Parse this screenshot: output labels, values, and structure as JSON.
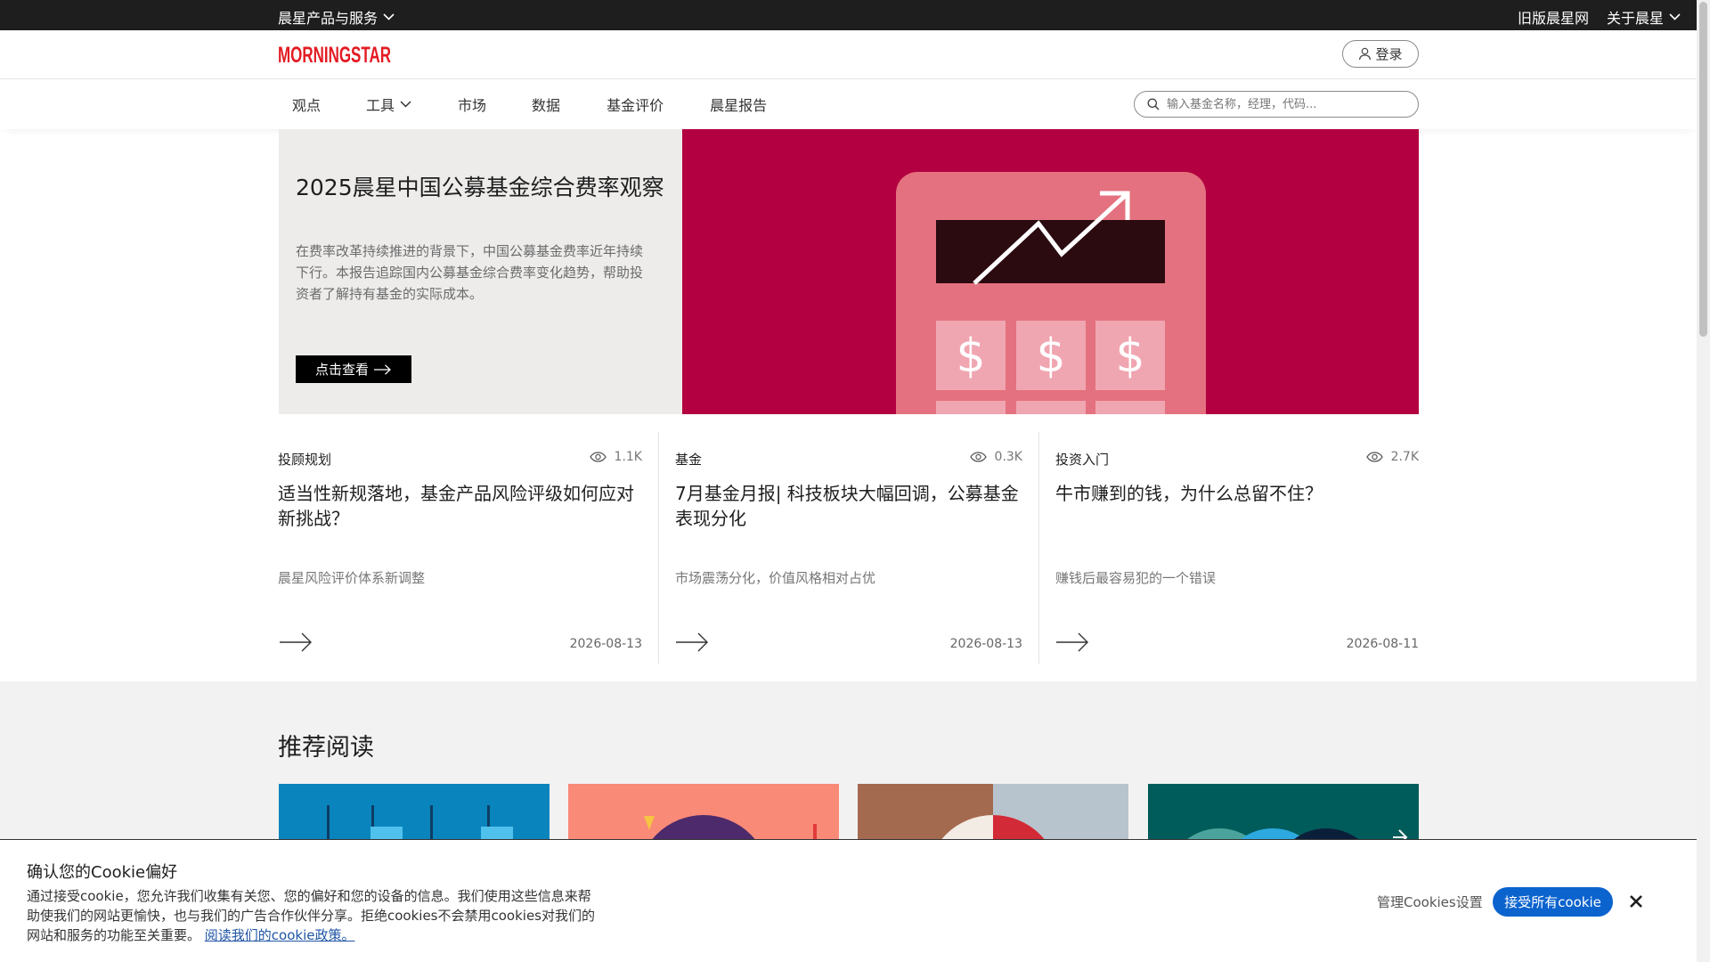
{
  "topbar": {
    "products_label": "晨星产品与服务",
    "old_site_label": "旧版晨星网",
    "about_label": "关于晨星"
  },
  "header": {
    "logo_text": "MORNINGSTAR",
    "login_label": "登录"
  },
  "nav": {
    "items": [
      {
        "label": "观点"
      },
      {
        "label": "工具"
      },
      {
        "label": "市场"
      },
      {
        "label": "数据"
      },
      {
        "label": "基金评价"
      },
      {
        "label": "晨星报告"
      }
    ],
    "search_placeholder": "输入基金名称，经理，代码..."
  },
  "hero": {
    "title": "2025晨星中国公募基金综合费率观察",
    "description": "在费率改革持续推进的背景下，中国公募基金费率近年持续下行。本报告追踪国内公募基金综合费率变化趋势，帮助投资者了解持有基金的实际成本。",
    "button_label": "点击查看",
    "background_color": "#b20040",
    "calculator_symbols": [
      "$",
      "$",
      "$"
    ]
  },
  "articles": [
    {
      "category": "投顾规划",
      "views": "1.1K",
      "title": "适当性新规落地，基金产品风险评级如何应对新挑战？",
      "subtitle": "晨星风险评价体系新调整",
      "date": "2026-08-13"
    },
    {
      "category": "基金",
      "views": "0.3K",
      "title": "7月基金月报| 科技板块大幅回调，公募基金表现分化",
      "subtitle": "市场震荡分化，价值风格相对占优",
      "date": "2026-08-13"
    },
    {
      "category": "投资入门",
      "views": "2.7K",
      "title": "牛市赚到的钱，为什么总留不住？",
      "subtitle": "赚钱后最容易犯的一个错误",
      "date": "2026-08-11"
    }
  ],
  "recommended": {
    "title": "推荐阅读"
  },
  "cookie_banner": {
    "title": "确认您的Cookie偏好",
    "text": "通过接受cookie，您允许我们收集有关您、您的偏好和您的设备的信息。我们使用这些信息来帮助使我们的网站更愉快，也与我们的广告合作伙伴分享。拒绝cookies不会禁用cookies对我们的网站和服务的功能至关重要。",
    "link_label": "阅读我们的cookie政策。",
    "manage_label": "管理Cookies设置",
    "accept_label": "接受所有cookie"
  }
}
